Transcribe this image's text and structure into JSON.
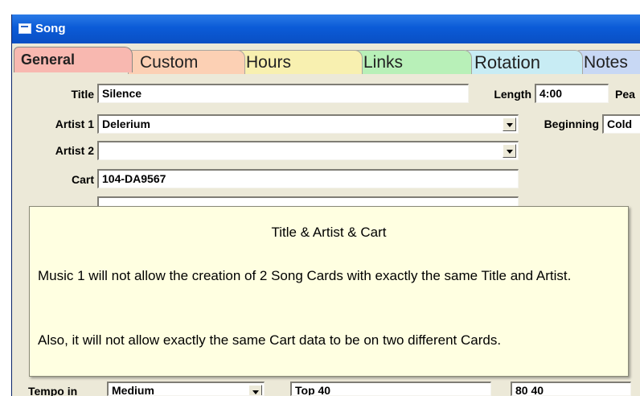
{
  "window": {
    "title": "Song"
  },
  "tabs": [
    {
      "label": "General",
      "color": "#f8b8b0"
    },
    {
      "label": "Custom",
      "color": "#fcd0b4"
    },
    {
      "label": "Hours",
      "color": "#f8f0b0"
    },
    {
      "label": "Links",
      "color": "#b8f0b8"
    },
    {
      "label": "Rotation",
      "color": "#c8ecf4"
    },
    {
      "label": "Notes",
      "color": "#c8d8f4"
    }
  ],
  "fields": {
    "title": {
      "label": "Title",
      "value": "Silence"
    },
    "length": {
      "label": "Length",
      "value": "4:00"
    },
    "peak": {
      "label": "Pea"
    },
    "artist1": {
      "label": "Artist 1",
      "value": "Delerium"
    },
    "beginning": {
      "label": "Beginning",
      "value": "Cold"
    },
    "artist2": {
      "label": "Artist 2",
      "value": ""
    },
    "cart": {
      "label": "Cart",
      "value": "104-DA9567"
    },
    "tempo_in": {
      "label": "Tempo in",
      "value": "Medium"
    },
    "partial1": "Top 40",
    "partial2": "80 40"
  },
  "tooltip": {
    "title": "Title & Artist & Cart",
    "paragraph1": "Music 1 will not allow the creation of 2 Song Cards with exactly the same Title and Artist.",
    "paragraph2": "Also, it will not allow exactly the same Cart data to be on two different Cards."
  }
}
